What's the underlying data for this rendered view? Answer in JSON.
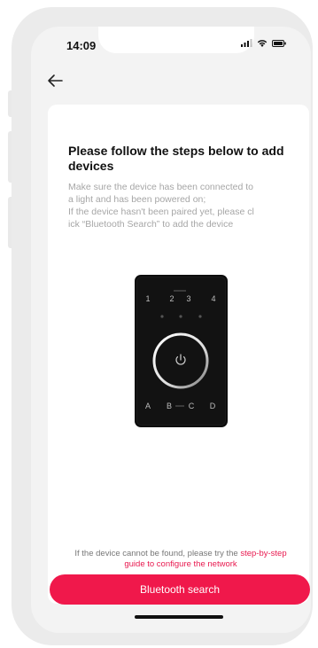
{
  "status_bar": {
    "time": "14:09",
    "icons": [
      "signal-icon",
      "wifi-icon",
      "battery-icon"
    ]
  },
  "nav": {
    "back_icon": "arrow-left-icon"
  },
  "card": {
    "title": "Please follow the steps below to add devices",
    "description": "Make sure the device has been connected to\n a light and has been powered on;\nIf the device hasn't been paired yet, please cl\nick “Bluetooth Search” to add the device",
    "device_image": {
      "top_labels": [
        "1",
        "2",
        "3",
        "4"
      ],
      "bottom_labels": [
        "A",
        "B",
        "C",
        "D"
      ],
      "center_icon": "power-icon"
    },
    "note_prefix": "If the device cannot be found, please try the",
    "note_link": "step-by-step guide to configure the network"
  },
  "actions": {
    "bluetooth_search": "Bluetooth search"
  },
  "colors": {
    "accent": "#f0184b",
    "link": "#e8194f"
  }
}
